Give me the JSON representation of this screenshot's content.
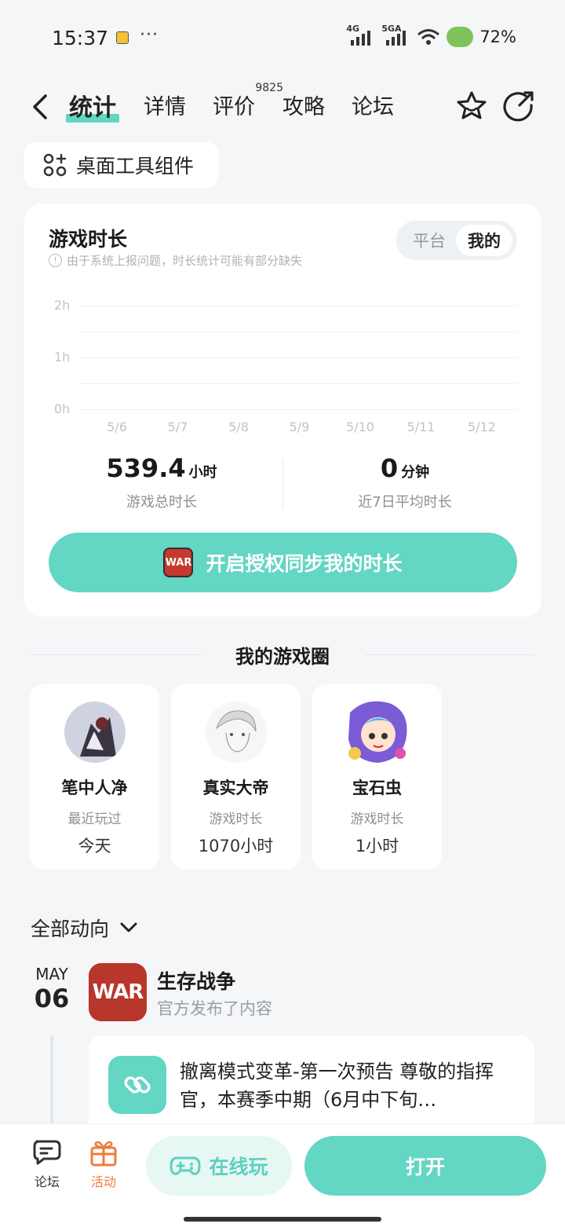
{
  "status_bar": {
    "time": "15:37",
    "dots": "···",
    "net1": "4G",
    "net2": "5GA",
    "battery": "72%"
  },
  "nav": {
    "tabs": [
      {
        "label": "统计",
        "active": true
      },
      {
        "label": "详情"
      },
      {
        "label": "评价",
        "badge": "9825"
      },
      {
        "label": "攻略"
      },
      {
        "label": "论坛"
      }
    ]
  },
  "widget_chip": {
    "label": "桌面工具组件"
  },
  "playtime": {
    "title": "游戏时长",
    "note": "由于系统上报问题，时长统计可能有部分缺失",
    "toggle": {
      "platform": "平台",
      "mine": "我的",
      "selected": "我的"
    },
    "total": {
      "value": "539.4",
      "unit": "小时",
      "caption": "游戏总时长"
    },
    "avg": {
      "value": "0",
      "unit": "分钟",
      "caption": "近7日平均时长"
    },
    "sync_button": "开启授权同步我的时长",
    "game_badge": "WAR"
  },
  "chart_data": {
    "type": "bar",
    "categories": [
      "5/6",
      "5/7",
      "5/8",
      "5/9",
      "5/10",
      "5/11",
      "5/12"
    ],
    "values": [
      0,
      0,
      0,
      0,
      0,
      0,
      0
    ],
    "ylim": [
      0,
      2
    ],
    "yticks": [
      "2h",
      "1h",
      "0h"
    ],
    "grid": true
  },
  "circle": {
    "title": "我的游戏圈",
    "friends": [
      {
        "name": "笔中人净",
        "key": "最近玩过",
        "value": "今天"
      },
      {
        "name": "真实大帝",
        "key": "游戏时长",
        "value": "1070小时"
      },
      {
        "name": "宝石虫",
        "key": "游戏时长",
        "value": "1小时"
      }
    ]
  },
  "feed": {
    "filter": "全部动向",
    "month": "MAY",
    "day": "06",
    "game_name": "生存战争",
    "game_icon_text": "WAR",
    "subtitle": "官方发布了内容",
    "post_text": "撤离模式变革-第一次预告 尊敬的指挥官，本赛季中期（6月中下旬…"
  },
  "bottom": {
    "forum": "论坛",
    "activity": "活动",
    "online": "在线玩",
    "open": "打开"
  },
  "colors": {
    "accent": "#63d6c4",
    "activity": "#ee7c3e"
  }
}
